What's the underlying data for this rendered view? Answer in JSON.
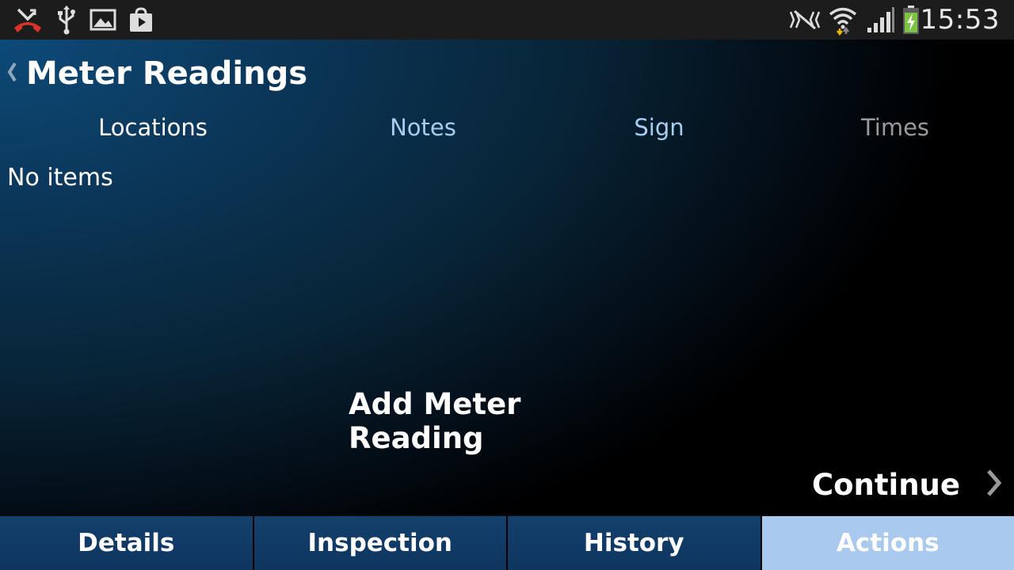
{
  "status_bar": {
    "time": "15:53",
    "left_icons": [
      "missed-call-icon",
      "usb-icon",
      "gallery-icon",
      "play-store-icon"
    ],
    "right_icons": [
      "nfc-icon",
      "wifi-icon",
      "signal-icon",
      "battery-charging-icon"
    ]
  },
  "header": {
    "title": "Meter Readings",
    "back_icon": "chevron-left-icon"
  },
  "tabs": [
    {
      "label": "Locations",
      "color": "#ffffff"
    },
    {
      "label": "Notes",
      "color": "#a8cdf2"
    },
    {
      "label": "Sign",
      "color": "#a8cdf2"
    },
    {
      "label": "Times",
      "color": "#9a9a9a"
    }
  ],
  "list": {
    "empty_text": "No items"
  },
  "actions": {
    "add_label": "Add Meter Reading",
    "continue_label": "Continue"
  },
  "bottom_nav": [
    {
      "label": "Details",
      "active": false
    },
    {
      "label": "Inspection",
      "active": false
    },
    {
      "label": "History",
      "active": false
    },
    {
      "label": "Actions",
      "active": true
    }
  ],
  "colors": {
    "accent_active_tab": "#a9c9ee",
    "nav_bg": "#123c68",
    "status_bar_bg": "#1c1c1c"
  }
}
